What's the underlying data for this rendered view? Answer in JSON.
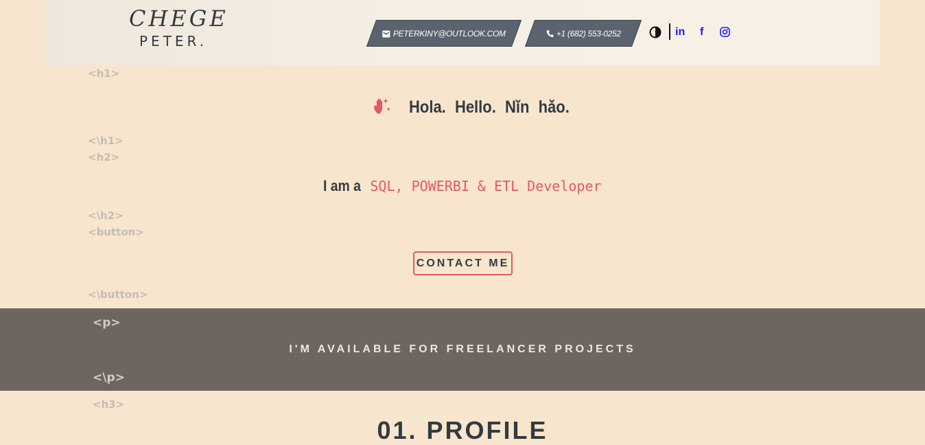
{
  "header": {
    "logo_top": "CHEGE",
    "logo_bottom": "PETER.",
    "email": "PETERKINY@OUTLOOK.COM",
    "phone": "+1 (682) 553-0252",
    "linkedin_label": "in",
    "facebook_label": "f"
  },
  "tags": {
    "h1_open": "<h1>",
    "h1_close": "<\\h1>",
    "h2_open": "<h2>",
    "h2_close": "<\\h2>",
    "button_open": "<button>",
    "button_close": "<\\button>",
    "p_open": "<p>",
    "p_close": "<\\p>",
    "h3_open": "<h3>"
  },
  "hero": {
    "greeting": "Hola. Hello. Nǐn hǎo.",
    "iam_lead": "I am a",
    "role": "SQL, POWERBI & ETL Developer",
    "contact_button": "CONTACT ME"
  },
  "band": {
    "text": "I'M AVAILABLE FOR FREELANCER PROJECTS"
  },
  "section": {
    "title": "01. PROFILE"
  },
  "icons": {
    "email": "envelope-icon",
    "phone": "phone-icon",
    "theme": "contrast-icon",
    "linkedin": "linkedin-icon",
    "facebook": "facebook-icon",
    "instagram": "instagram-icon",
    "wave": "waving-hand-icon"
  },
  "colors": {
    "accent": "#e4576a",
    "band": "#6d6560",
    "background": "#f7e6cd",
    "social": "#1a1aff"
  }
}
